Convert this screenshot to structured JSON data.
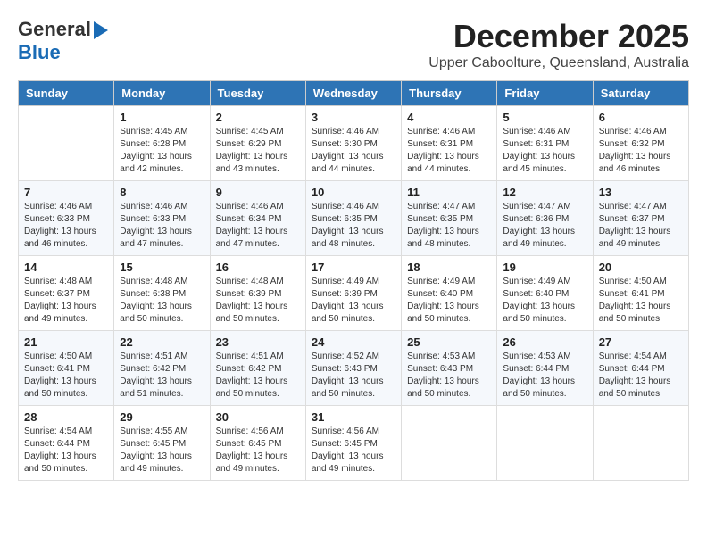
{
  "logo": {
    "line1": "General",
    "line2": "Blue"
  },
  "title": "December 2025",
  "subtitle": "Upper Caboolture, Queensland, Australia",
  "weekdays": [
    "Sunday",
    "Monday",
    "Tuesday",
    "Wednesday",
    "Thursday",
    "Friday",
    "Saturday"
  ],
  "weeks": [
    [
      {
        "day": "",
        "info": ""
      },
      {
        "day": "1",
        "info": "Sunrise: 4:45 AM\nSunset: 6:28 PM\nDaylight: 13 hours\nand 42 minutes."
      },
      {
        "day": "2",
        "info": "Sunrise: 4:45 AM\nSunset: 6:29 PM\nDaylight: 13 hours\nand 43 minutes."
      },
      {
        "day": "3",
        "info": "Sunrise: 4:46 AM\nSunset: 6:30 PM\nDaylight: 13 hours\nand 44 minutes."
      },
      {
        "day": "4",
        "info": "Sunrise: 4:46 AM\nSunset: 6:31 PM\nDaylight: 13 hours\nand 44 minutes."
      },
      {
        "day": "5",
        "info": "Sunrise: 4:46 AM\nSunset: 6:31 PM\nDaylight: 13 hours\nand 45 minutes."
      },
      {
        "day": "6",
        "info": "Sunrise: 4:46 AM\nSunset: 6:32 PM\nDaylight: 13 hours\nand 46 minutes."
      }
    ],
    [
      {
        "day": "7",
        "info": "Sunrise: 4:46 AM\nSunset: 6:33 PM\nDaylight: 13 hours\nand 46 minutes."
      },
      {
        "day": "8",
        "info": "Sunrise: 4:46 AM\nSunset: 6:33 PM\nDaylight: 13 hours\nand 47 minutes."
      },
      {
        "day": "9",
        "info": "Sunrise: 4:46 AM\nSunset: 6:34 PM\nDaylight: 13 hours\nand 47 minutes."
      },
      {
        "day": "10",
        "info": "Sunrise: 4:46 AM\nSunset: 6:35 PM\nDaylight: 13 hours\nand 48 minutes."
      },
      {
        "day": "11",
        "info": "Sunrise: 4:47 AM\nSunset: 6:35 PM\nDaylight: 13 hours\nand 48 minutes."
      },
      {
        "day": "12",
        "info": "Sunrise: 4:47 AM\nSunset: 6:36 PM\nDaylight: 13 hours\nand 49 minutes."
      },
      {
        "day": "13",
        "info": "Sunrise: 4:47 AM\nSunset: 6:37 PM\nDaylight: 13 hours\nand 49 minutes."
      }
    ],
    [
      {
        "day": "14",
        "info": "Sunrise: 4:48 AM\nSunset: 6:37 PM\nDaylight: 13 hours\nand 49 minutes."
      },
      {
        "day": "15",
        "info": "Sunrise: 4:48 AM\nSunset: 6:38 PM\nDaylight: 13 hours\nand 50 minutes."
      },
      {
        "day": "16",
        "info": "Sunrise: 4:48 AM\nSunset: 6:39 PM\nDaylight: 13 hours\nand 50 minutes."
      },
      {
        "day": "17",
        "info": "Sunrise: 4:49 AM\nSunset: 6:39 PM\nDaylight: 13 hours\nand 50 minutes."
      },
      {
        "day": "18",
        "info": "Sunrise: 4:49 AM\nSunset: 6:40 PM\nDaylight: 13 hours\nand 50 minutes."
      },
      {
        "day": "19",
        "info": "Sunrise: 4:49 AM\nSunset: 6:40 PM\nDaylight: 13 hours\nand 50 minutes."
      },
      {
        "day": "20",
        "info": "Sunrise: 4:50 AM\nSunset: 6:41 PM\nDaylight: 13 hours\nand 50 minutes."
      }
    ],
    [
      {
        "day": "21",
        "info": "Sunrise: 4:50 AM\nSunset: 6:41 PM\nDaylight: 13 hours\nand 50 minutes."
      },
      {
        "day": "22",
        "info": "Sunrise: 4:51 AM\nSunset: 6:42 PM\nDaylight: 13 hours\nand 51 minutes."
      },
      {
        "day": "23",
        "info": "Sunrise: 4:51 AM\nSunset: 6:42 PM\nDaylight: 13 hours\nand 50 minutes."
      },
      {
        "day": "24",
        "info": "Sunrise: 4:52 AM\nSunset: 6:43 PM\nDaylight: 13 hours\nand 50 minutes."
      },
      {
        "day": "25",
        "info": "Sunrise: 4:53 AM\nSunset: 6:43 PM\nDaylight: 13 hours\nand 50 minutes."
      },
      {
        "day": "26",
        "info": "Sunrise: 4:53 AM\nSunset: 6:44 PM\nDaylight: 13 hours\nand 50 minutes."
      },
      {
        "day": "27",
        "info": "Sunrise: 4:54 AM\nSunset: 6:44 PM\nDaylight: 13 hours\nand 50 minutes."
      }
    ],
    [
      {
        "day": "28",
        "info": "Sunrise: 4:54 AM\nSunset: 6:44 PM\nDaylight: 13 hours\nand 50 minutes."
      },
      {
        "day": "29",
        "info": "Sunrise: 4:55 AM\nSunset: 6:45 PM\nDaylight: 13 hours\nand 49 minutes."
      },
      {
        "day": "30",
        "info": "Sunrise: 4:56 AM\nSunset: 6:45 PM\nDaylight: 13 hours\nand 49 minutes."
      },
      {
        "day": "31",
        "info": "Sunrise: 4:56 AM\nSunset: 6:45 PM\nDaylight: 13 hours\nand 49 minutes."
      },
      {
        "day": "",
        "info": ""
      },
      {
        "day": "",
        "info": ""
      },
      {
        "day": "",
        "info": ""
      }
    ]
  ]
}
